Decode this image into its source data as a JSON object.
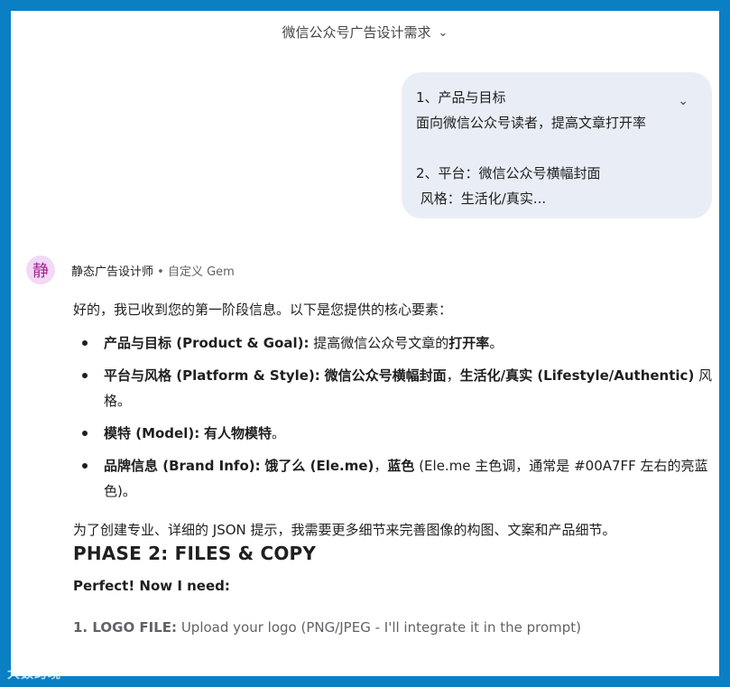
{
  "header": {
    "title": "微信公众号广告设计需求",
    "chevron_icon": "chevron-down-icon"
  },
  "user_message": {
    "lines": [
      "1、产品与目标",
      "面向微信公众号读者，提高文章打开率",
      "",
      "2、平台：微信公众号横幅封面",
      " 风格：生活化/真实..."
    ],
    "expand_icon": "chevron-down-icon"
  },
  "gem": {
    "avatar_char": "静",
    "name": "静态广告设计师",
    "separator": " • ",
    "meta": "自定义 Gem"
  },
  "response": {
    "intro": "好的，我已收到您的第一阶段信息。以下是您提供的核心要素：",
    "bullets": [
      {
        "b1": "产品与目标 (Product & Goal):",
        "t1": " 提高微信公众号文章的",
        "b2": "打开率",
        "t2": "。"
      },
      {
        "b1": "平台与风格 (Platform & Style):",
        "t1": " ",
        "b2": "微信公众号横幅封面",
        "t2": "，",
        "b3": "生活化/真实 (Lifestyle/Authentic)",
        "t3": " 风格。"
      },
      {
        "b1": "模特 (Model):",
        "t1": " ",
        "b2": "有人物模特",
        "t2": "。"
      },
      {
        "b1": "品牌信息 (Brand Info):",
        "t1": " ",
        "b2": "饿了么 (Ele.me)",
        "t2": "，",
        "b3": "蓝色",
        "t3": " (Ele.me 主色调，通常是 #00A7FF 左右的亮蓝色)。"
      }
    ],
    "paragraph2": "为了创建专业、详细的 JSON 提示，我需要更多细节来完善图像的构图、文案和产品细节。",
    "phase_heading": "PHASE 2: FILES & COPY",
    "perfect": "Perfect! Now I need:",
    "logo_label": "1. LOGO FILE:",
    "logo_text": " Upload your logo (PNG/JPEG - I'll integrate it in the prompt)"
  },
  "watermark": "大数跨境",
  "colors": {
    "border_blue": "#0b7fc4",
    "bubble_bg": "#e9eef6",
    "avatar_bg": "#f3d9f6"
  }
}
